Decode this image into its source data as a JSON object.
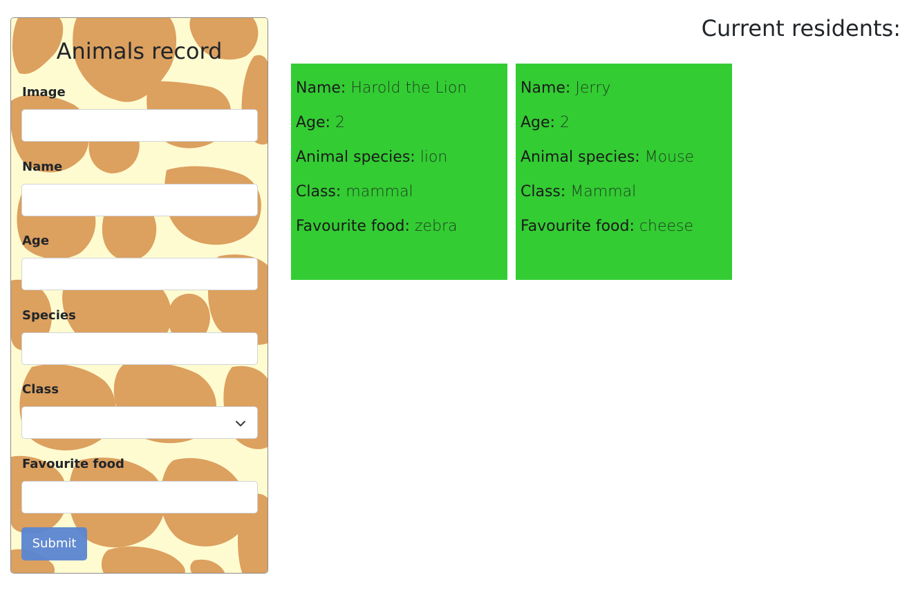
{
  "form": {
    "title": "Animals record",
    "fields": [
      {
        "label": "Image",
        "value": "",
        "type": "text"
      },
      {
        "label": "Name",
        "value": "",
        "type": "text"
      },
      {
        "label": "Age",
        "value": "",
        "type": "text"
      },
      {
        "label": "Species",
        "value": "",
        "type": "text"
      },
      {
        "label": "Class",
        "value": "",
        "type": "select"
      },
      {
        "label": "Favourite food",
        "value": "",
        "type": "text"
      }
    ],
    "submit_label": "Submit",
    "background_colors": {
      "base": "#fffbd0",
      "spots": "#dca05f"
    },
    "submit_color": "#5a86d2"
  },
  "residents": {
    "heading": "Current residents:",
    "card_color": "#33cc33",
    "cards": [
      {
        "rows": [
          {
            "key": "Name:",
            "value": "Harold the Lion"
          },
          {
            "key": "Age:",
            "value": "2"
          },
          {
            "key": "Animal species:",
            "value": "lion"
          },
          {
            "key": "Class:",
            "value": "mammal"
          },
          {
            "key": "Favourite food:",
            "value": "zebra"
          }
        ]
      },
      {
        "rows": [
          {
            "key": "Name:",
            "value": "Jerry"
          },
          {
            "key": "Age:",
            "value": "2"
          },
          {
            "key": "Animal species:",
            "value": "Mouse"
          },
          {
            "key": "Class:",
            "value": "Mammal"
          },
          {
            "key": "Favourite food:",
            "value": "cheese"
          }
        ]
      }
    ]
  }
}
